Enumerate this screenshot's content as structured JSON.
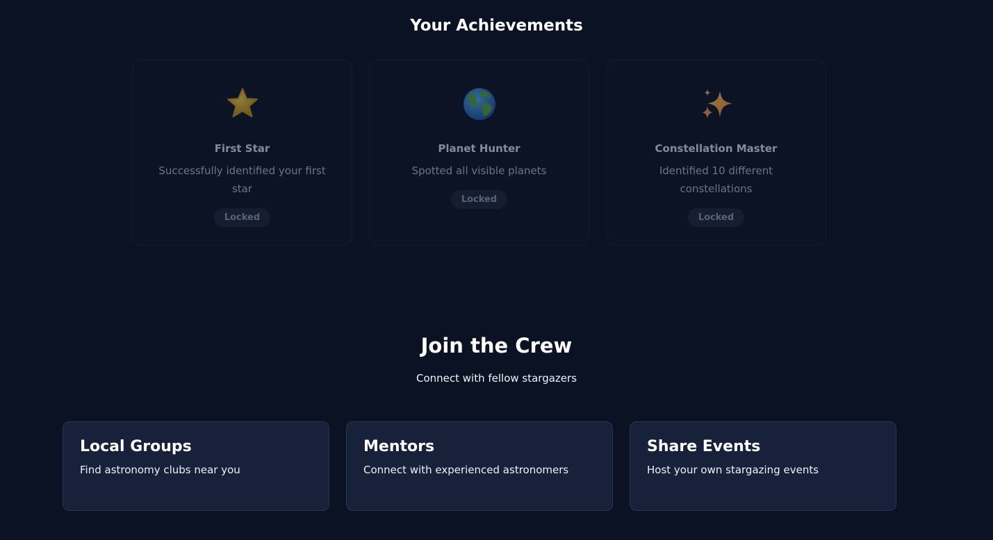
{
  "achievements": {
    "title": "Your Achievements",
    "items": [
      {
        "icon": "star-icon",
        "name": "First Star",
        "description": "Successfully identified your first star",
        "status": "Locked"
      },
      {
        "icon": "earth-globe-icon",
        "name": "Planet Hunter",
        "description": "Spotted all visible planets",
        "status": "Locked"
      },
      {
        "icon": "sparkles-icon",
        "name": "Constellation Master",
        "description": "Identified 10 different constellations",
        "status": "Locked"
      }
    ]
  },
  "crew": {
    "title": "Join the Crew",
    "subtitle": "Connect with fellow stargazers",
    "cards": [
      {
        "title": "Local Groups",
        "description": "Find astronomy clubs near you"
      },
      {
        "title": "Mentors",
        "description": "Connect with experienced astronomers"
      },
      {
        "title": "Share Events",
        "description": "Host your own stargazing events"
      }
    ]
  }
}
